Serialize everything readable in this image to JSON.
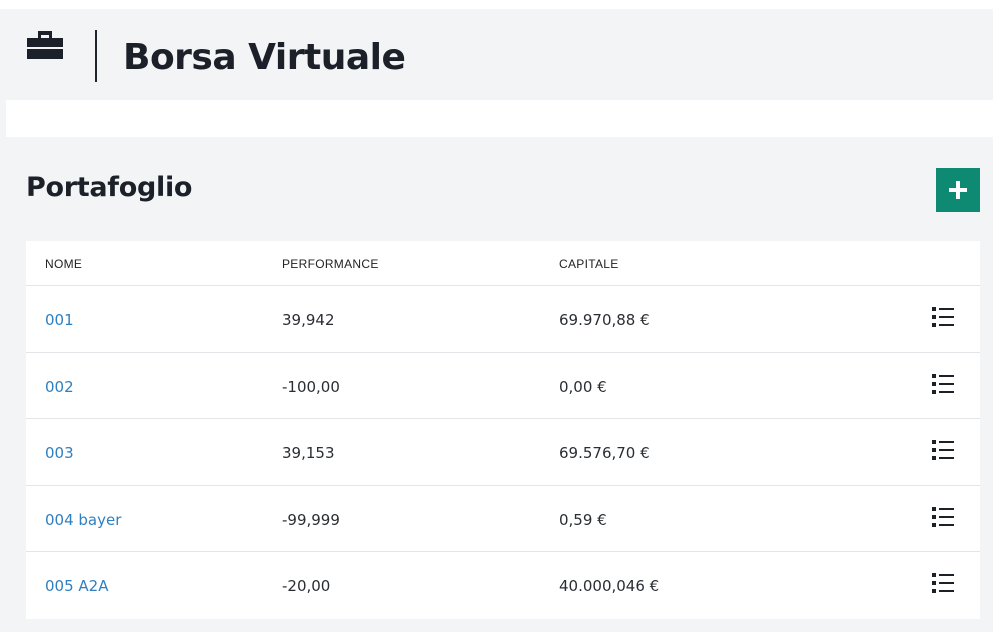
{
  "header": {
    "title": "Borsa Virtuale",
    "icon": "briefcase-icon"
  },
  "portfolio": {
    "title": "Portafoglio",
    "add_button_icon": "plus-icon",
    "accent_color": "#0f8a72",
    "columns": {
      "name": "NOME",
      "performance": "PERFORMANCE",
      "capital": "CAPITALE"
    },
    "rows": [
      {
        "name": "001",
        "performance": "39,942",
        "capital": "69.970,88 €"
      },
      {
        "name": "002",
        "performance": "-100,00",
        "capital": "0,00 €"
      },
      {
        "name": "003",
        "performance": "39,153",
        "capital": "69.576,70 €"
      },
      {
        "name": "004 bayer",
        "performance": "-99,999",
        "capital": "0,59 €"
      },
      {
        "name": "005 A2A",
        "performance": "-20,00",
        "capital": "40.000,046 €"
      }
    ],
    "row_action_icon": "list-icon",
    "link_color": "#2f7fc1"
  }
}
